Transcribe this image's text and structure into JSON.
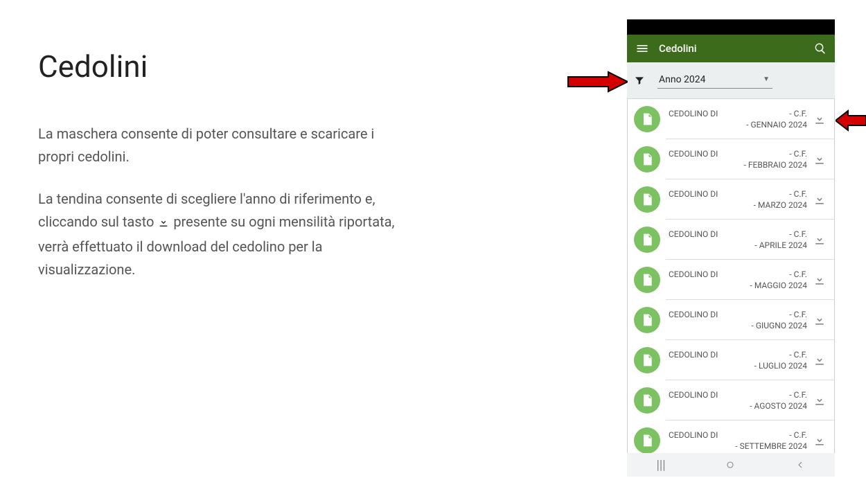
{
  "doc": {
    "heading": "Cedolini",
    "p1": "La maschera consente di poter consultare e scaricare i propri cedolini.",
    "p2a": "La tendina consente di scegliere l'anno di riferimento e, cliccando sul tasto ",
    "p2b": "  presente su ogni mensilità riportata, verrà effettuato il download del cedolino per la visualizzazione."
  },
  "app": {
    "title": "Cedolini",
    "filter": {
      "selected_year": "Anno 2024"
    },
    "rows": [
      {
        "title": "CEDOLINO DI",
        "suffix": "- C.F.",
        "period": "- GENNAIO 2024"
      },
      {
        "title": "CEDOLINO DI",
        "suffix": "- C.F.",
        "period": "- FEBBRAIO 2024"
      },
      {
        "title": "CEDOLINO DI",
        "suffix": "- C.F.",
        "period": "- MARZO 2024"
      },
      {
        "title": "CEDOLINO DI",
        "suffix": "- C.F.",
        "period": "- APRILE 2024"
      },
      {
        "title": "CEDOLINO DI",
        "suffix": "- C.F.",
        "period": "- MAGGIO 2024"
      },
      {
        "title": "CEDOLINO DI",
        "suffix": "- C.F.",
        "period": "- GIUGNO 2024"
      },
      {
        "title": "CEDOLINO DI",
        "suffix": "- C.F.",
        "period": "- LUGLIO 2024"
      },
      {
        "title": "CEDOLINO DI",
        "suffix": "- C.F.",
        "period": "- AGOSTO 2024"
      },
      {
        "title": "CEDOLINO DI",
        "suffix": "- C.F.",
        "period": "- SETTEMBRE 2024"
      }
    ]
  }
}
